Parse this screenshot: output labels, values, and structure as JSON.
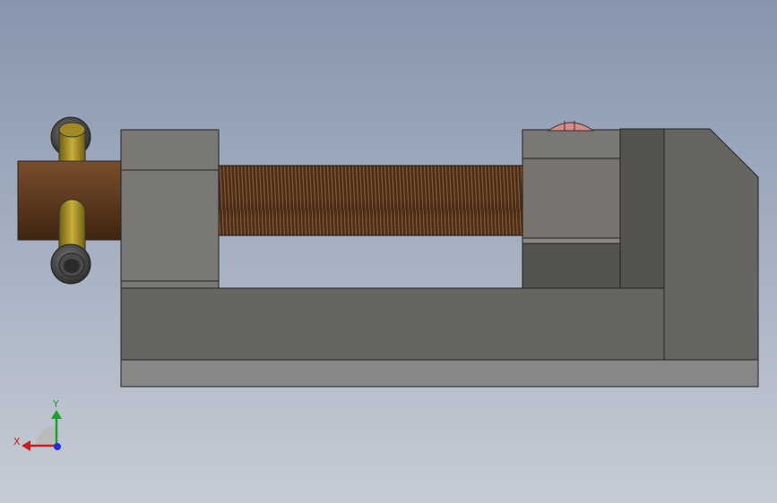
{
  "viewport": {
    "background_top": "#8796ad",
    "background_bottom": "#c6ccd5"
  },
  "model": {
    "parts": [
      "vise-body",
      "fixed-jaw",
      "movable-jaw",
      "lead-screw",
      "screw-handle-hub",
      "handle-bar",
      "handle-ball-top",
      "handle-ball-bottom",
      "jaw-screw-head"
    ],
    "colors": {
      "body": "#666561",
      "body_base": "#878785",
      "jaw": "#7a7874",
      "jaw_dark": "#55534f",
      "screw": "#5a3a22",
      "handle_bar": "#a9922a",
      "hub": "#6b4326",
      "ball": "#555555",
      "screw_head": "#d98a86"
    }
  },
  "triad": {
    "x_label": "X",
    "y_label": "Y",
    "x_color": "#c81e1e",
    "y_color": "#1e9e2e",
    "z_color": "#1e2ed8"
  }
}
